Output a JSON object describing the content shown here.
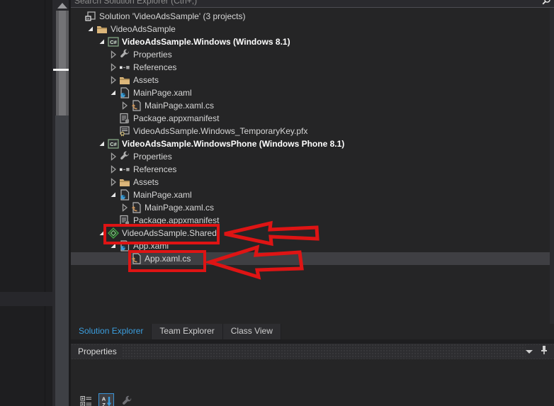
{
  "search": {
    "placeholder": "Search Solution Explorer (Ctrl+;)"
  },
  "solution_explorer": {
    "tree": [
      {
        "label": "Solution 'VideoAdsSample' (3 projects)",
        "level": 0,
        "icon": "solution",
        "expander": "none",
        "bold": false,
        "selected": false
      },
      {
        "label": "VideoAdsSample",
        "level": 1,
        "icon": "folder",
        "expander": "expanded",
        "bold": false,
        "selected": false
      },
      {
        "label": "VideoAdsSample.Windows (Windows 8.1)",
        "level": 2,
        "icon": "csproj",
        "expander": "expanded",
        "bold": true,
        "selected": false
      },
      {
        "label": "Properties",
        "level": 3,
        "icon": "wrench",
        "expander": "collapsed",
        "bold": false,
        "selected": false
      },
      {
        "label": "References",
        "level": 3,
        "icon": "refs",
        "expander": "collapsed",
        "bold": false,
        "selected": false
      },
      {
        "label": "Assets",
        "level": 3,
        "icon": "folder",
        "expander": "collapsed",
        "bold": false,
        "selected": false
      },
      {
        "label": "MainPage.xaml",
        "level": 3,
        "icon": "xaml",
        "expander": "expanded",
        "bold": false,
        "selected": false
      },
      {
        "label": "MainPage.xaml.cs",
        "level": 4,
        "icon": "csfile",
        "expander": "collapsed",
        "bold": false,
        "selected": false
      },
      {
        "label": "Package.appxmanifest",
        "level": 3,
        "icon": "manifest",
        "expander": "none",
        "bold": false,
        "selected": false
      },
      {
        "label": "VideoAdsSample.Windows_TemporaryKey.pfx",
        "level": 3,
        "icon": "pfx",
        "expander": "none",
        "bold": false,
        "selected": false
      },
      {
        "label": "VideoAdsSample.WindowsPhone (Windows Phone 8.1)",
        "level": 2,
        "icon": "csproj",
        "expander": "expanded",
        "bold": true,
        "selected": false
      },
      {
        "label": "Properties",
        "level": 3,
        "icon": "wrench",
        "expander": "collapsed",
        "bold": false,
        "selected": false
      },
      {
        "label": "References",
        "level": 3,
        "icon": "refs",
        "expander": "collapsed",
        "bold": false,
        "selected": false
      },
      {
        "label": "Assets",
        "level": 3,
        "icon": "folder",
        "expander": "collapsed",
        "bold": false,
        "selected": false
      },
      {
        "label": "MainPage.xaml",
        "level": 3,
        "icon": "xaml",
        "expander": "expanded",
        "bold": false,
        "selected": false
      },
      {
        "label": "MainPage.xaml.cs",
        "level": 4,
        "icon": "csfile",
        "expander": "collapsed",
        "bold": false,
        "selected": false
      },
      {
        "label": "Package.appxmanifest",
        "level": 3,
        "icon": "manifest",
        "expander": "none",
        "bold": false,
        "selected": false
      },
      {
        "label": "VideoAdsSample.Shared",
        "level": 2,
        "icon": "shared",
        "expander": "expanded",
        "bold": false,
        "selected": false
      },
      {
        "label": "App.xaml",
        "level": 3,
        "icon": "xaml",
        "expander": "expanded",
        "bold": false,
        "selected": false
      },
      {
        "label": "App.xaml.cs",
        "level": 4,
        "icon": "csfile",
        "expander": "none",
        "bold": false,
        "selected": true
      }
    ]
  },
  "tabs": [
    {
      "label": "Solution Explorer",
      "active": true
    },
    {
      "label": "Team Explorer",
      "active": false
    },
    {
      "label": "Class View",
      "active": false
    }
  ],
  "properties_panel": {
    "title": "Properties",
    "toolbar": [
      "categorized",
      "sort-alphabetical",
      "property-pages"
    ]
  },
  "colors": {
    "panel_bg": "#252526",
    "titlebar_bg": "#2d2d30",
    "selected_row": "#3f3f43",
    "text": "#d6d6d6",
    "active_tab_text": "#3b9ddd",
    "annotation_red": "#de1414",
    "folder_tan": "#dcb67a",
    "xaml_blue": "#3f9fd8",
    "shared_green": "#43a047",
    "sort_selected_border": "#3a93d6"
  }
}
